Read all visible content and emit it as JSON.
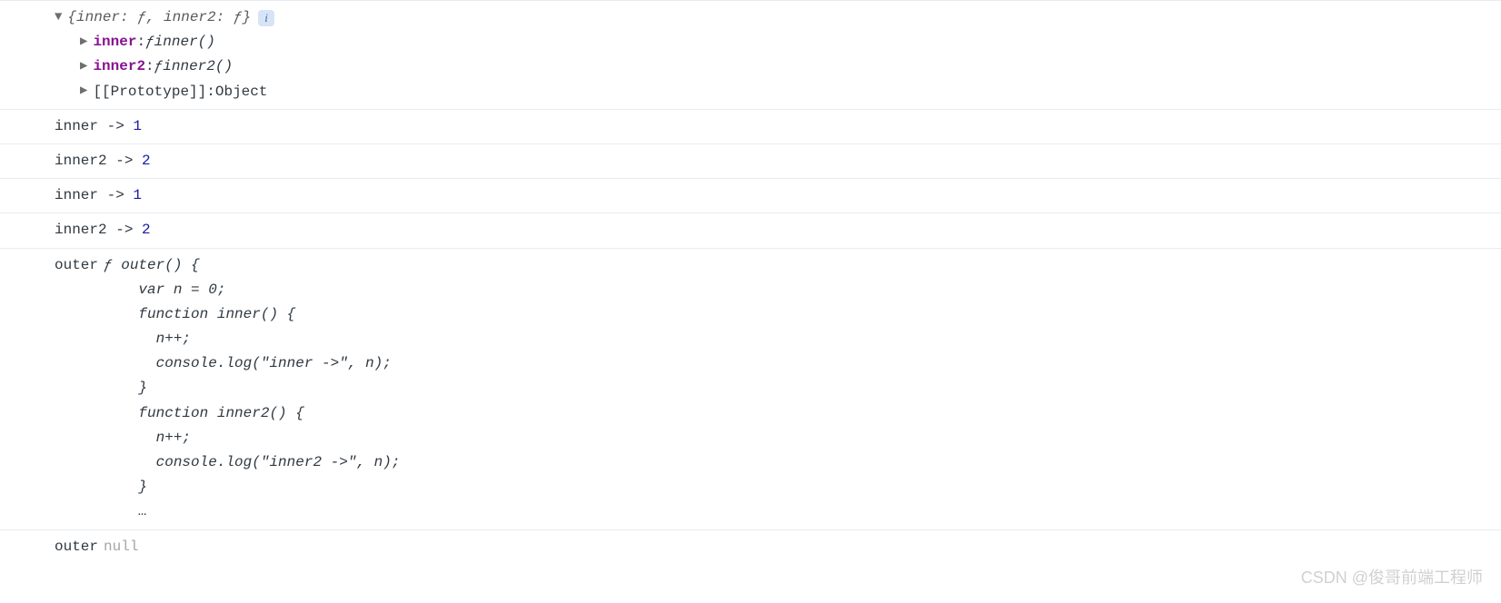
{
  "object": {
    "summary": "{inner: ƒ, inner2: ƒ}",
    "info_glyph": "i",
    "props": [
      {
        "key": "inner",
        "valPrefix": "ƒ ",
        "val": "inner()"
      },
      {
        "key": "inner2",
        "valPrefix": "ƒ ",
        "val": "inner2()"
      }
    ],
    "proto": {
      "key": "[[Prototype]]",
      "val": "Object"
    }
  },
  "logs": [
    {
      "label": "inner ->",
      "value": "1"
    },
    {
      "label": "inner2 ->",
      "value": "2"
    },
    {
      "label": "inner ->",
      "value": "1"
    },
    {
      "label": "inner2 ->",
      "value": "2"
    }
  ],
  "outer_fn": {
    "prefix": "outer",
    "code": "ƒ outer() {\n    var n = 0;\n    function inner() {\n      n++;\n      console.log(\"inner ->\", n);\n    }\n    function inner2() {\n      n++;\n      console.log(\"inner2 ->\", n);\n    }\n    …"
  },
  "outer_null": {
    "prefix": "outer",
    "value": "null"
  },
  "watermark": "CSDN @俊哥前端工程师"
}
